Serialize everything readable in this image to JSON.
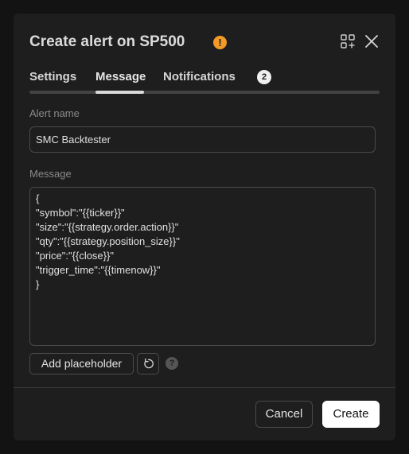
{
  "dialog": {
    "title": "Create alert on SP500",
    "warning_glyph": "!",
    "icons": {
      "warning": "warning-icon",
      "apps": "add-widget-icon",
      "close": "close-icon"
    }
  },
  "tabs": [
    {
      "label": "Settings",
      "active": false
    },
    {
      "label": "Message",
      "active": true
    },
    {
      "label": "Notifications",
      "active": false,
      "badge": "2"
    }
  ],
  "alert_name": {
    "label": "Alert name",
    "value": "SMC Backtester"
  },
  "message": {
    "label": "Message",
    "value": "{\n\"symbol\":\"{{ticker}}\"\n\"size\":\"{{strategy.order.action}}\"\n\"qty\":\"{{strategy.position_size}}\"\n\"price\":\"{{close}}\"\n\"trigger_time\":\"{{timenow}}\"\n}"
  },
  "placeholder_controls": {
    "add_label": "Add placeholder",
    "reset_icon": "reset-icon",
    "help_glyph": "?"
  },
  "footer": {
    "cancel_label": "Cancel",
    "create_label": "Create"
  },
  "colors": {
    "background": "#131313",
    "dialog": "#1e1e1e",
    "warning": "#f29b27",
    "primary_button": "#ffffff"
  }
}
